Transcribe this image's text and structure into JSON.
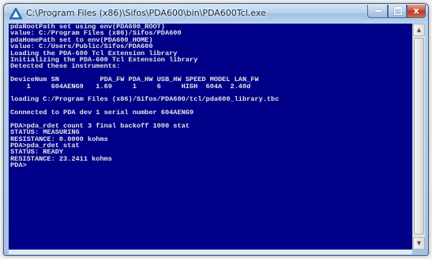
{
  "window": {
    "title": "C:\\Program Files (x86)\\Sifos\\PDA600\\bin\\PDA600Tcl.exe",
    "controls": {
      "minimize": "minimize",
      "maximize": "maximize",
      "close": "x"
    }
  },
  "console": {
    "background": "#000088",
    "text_color": "#e6e6e6",
    "lines": {
      "l01": "pdaRootPath set using env(PDA600_ROOT)",
      "l02": "value: C:/Program Files (x86)/Sifos/PDA600",
      "l03": "pdaHomePath set to env(PDA600_HOME)",
      "l04": "value: C:/Users/Public/Sifos/PDA600",
      "l05": "Loading the PDA-600 Tcl Extension library",
      "l06": "Initializing the PDA-600 Tcl Extension library",
      "l07": "Detected these instruments:",
      "l08": "DeviceNum SN          PDA_FW PDA_HW USB_HW SPEED MODEL LAN_FW",
      "l09": "    1     604AENG9   1.69     1     6     HIGH  604A  2.40d",
      "l10": "loading C:/Program Files (x86)/Sifos/PDA600/tcl/pda600_library.tbc",
      "l11": "Connected to PDA dev 1 serial number 604AENG9",
      "l12": "PDA>pda_rdet count 3 final backoff 1000 stat",
      "l13": "STATUS: MEASURING",
      "l14": "RESISTANCE: 0.0000 kohms",
      "l15": "PDA>pda_rdet stat",
      "l16": "STATUS: READY",
      "l17": "RESISTANCE: 23.2411 kohms",
      "l18": "PDA>"
    }
  },
  "scrollbar": {
    "up_arrow": "up-arrow",
    "down_arrow": "down-arrow",
    "position": 0.0
  }
}
